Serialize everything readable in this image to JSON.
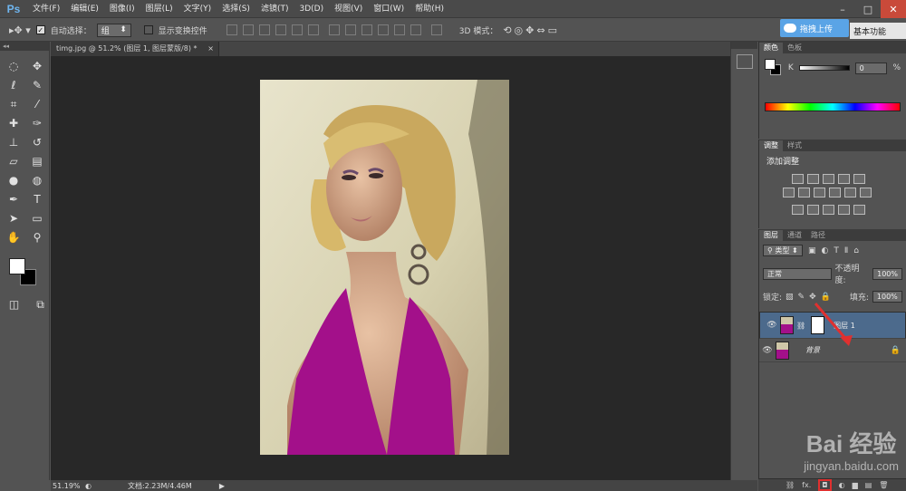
{
  "menubar": {
    "logo": "Ps",
    "items": [
      "文件(F)",
      "编辑(E)",
      "图像(I)",
      "图层(L)",
      "文字(Y)",
      "选择(S)",
      "滤镜(T)",
      "3D(D)",
      "视图(V)",
      "窗口(W)",
      "帮助(H)"
    ]
  },
  "options": {
    "auto_select_label": "自动选择：",
    "auto_select_value": "组",
    "show_transform_label": "显示变换控件",
    "mode_3d_label": "3D 模式：",
    "cloud_button": "拖拽上传",
    "workspace": "基本功能"
  },
  "document": {
    "tab_title": "timg.jpg @ 51.2% (图层 1, 图层蒙版/8) *",
    "zoom": "51.19%",
    "info": "文档:2.23M/4.46M"
  },
  "color_panel": {
    "tabs": [
      "颜色",
      "色板"
    ],
    "channel_label": "K",
    "channel_value": "0",
    "channel_unit": "%"
  },
  "adjust_panel": {
    "tabs": [
      "调整",
      "样式"
    ],
    "title": "添加调整"
  },
  "layers_panel": {
    "tabs": [
      "图层",
      "通道",
      "路径"
    ],
    "filter_label": "类型",
    "blend_mode": "正常",
    "opacity_label": "不透明度:",
    "opacity_value": "100%",
    "lock_label": "锁定:",
    "fill_label": "填充:",
    "fill_value": "100%",
    "layers": [
      {
        "name": "图层 1",
        "selected": true
      },
      {
        "name": "背景",
        "selected": false
      }
    ],
    "bottom_fx": "fx."
  },
  "watermark": {
    "brand": "Bai 经验",
    "url": "jingyan.baidu.com"
  },
  "colors": {
    "accent": "#5aa4e6",
    "selected_layer": "#4c6a8c",
    "dress": "#a3108a",
    "arrow": "#e0302f"
  }
}
